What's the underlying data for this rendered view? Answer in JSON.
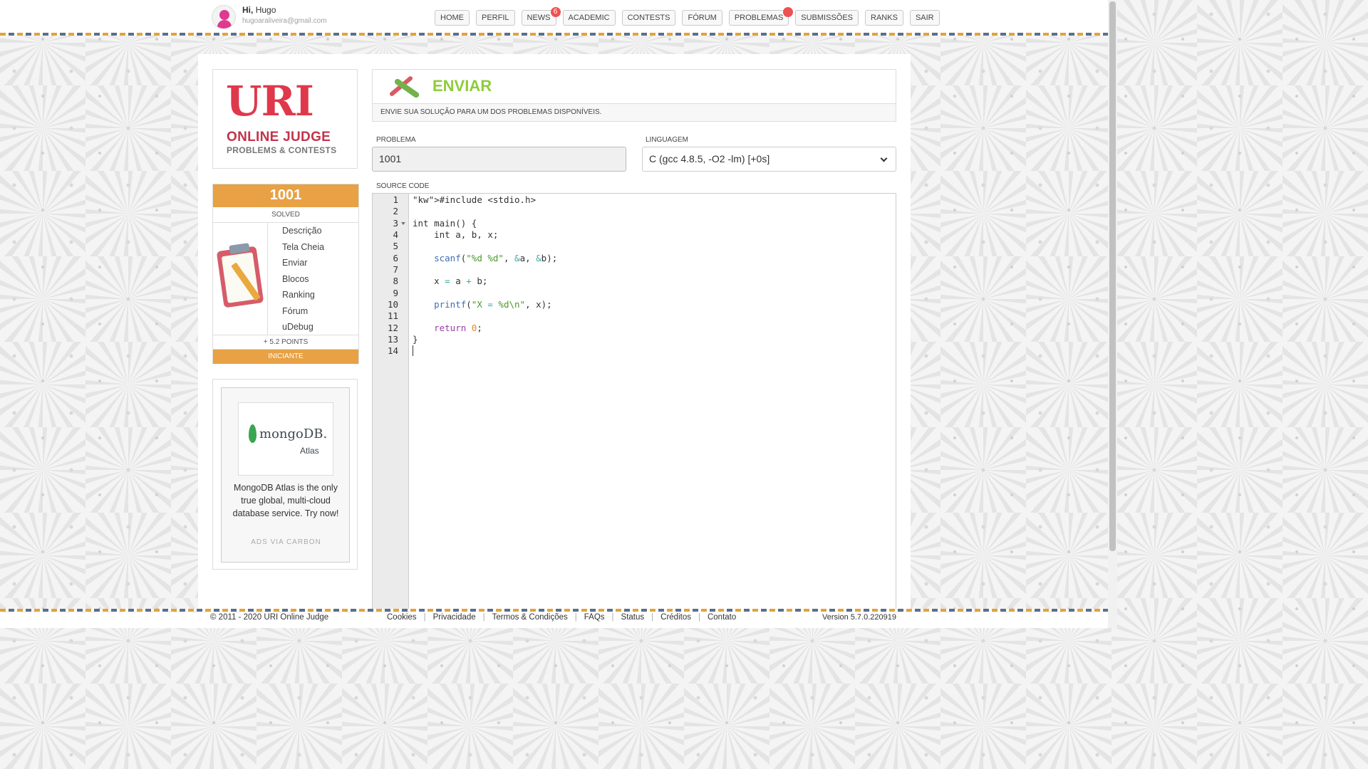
{
  "user": {
    "greeting": "Hi,",
    "name": "Hugo",
    "email": "hugoaraliveira@gmail.com"
  },
  "nav": [
    {
      "label": "HOME",
      "badge": ""
    },
    {
      "label": "PERFIL",
      "badge": ""
    },
    {
      "label": "NEWS",
      "badge": "6"
    },
    {
      "label": "ACADEMIC",
      "badge": ""
    },
    {
      "label": "CONTESTS",
      "badge": ""
    },
    {
      "label": "FÓRUM",
      "badge": ""
    },
    {
      "label": "PROBLEMAS",
      "badge": " "
    },
    {
      "label": "SUBMISSÕES",
      "badge": ""
    },
    {
      "label": "RANKS",
      "badge": ""
    },
    {
      "label": "SAIR",
      "badge": ""
    }
  ],
  "logo": {
    "line1": "URI",
    "line2": "ONLINE JUDGE",
    "line3": "PROBLEMS & CONTESTS"
  },
  "problem_card": {
    "number": "1001",
    "status": "SOLVED",
    "menu": [
      "Descrição",
      "Tela Cheia",
      "Enviar",
      "Blocos",
      "Ranking",
      "Fórum",
      "uDebug"
    ],
    "points": "+ 5.2 POINTS",
    "level": "INICIANTE"
  },
  "ad": {
    "brand": "mongoDB.",
    "product": "Atlas",
    "text": "MongoDB Atlas is the only true global, multi-cloud database service. Try now!",
    "via": "ADS VIA CARBON"
  },
  "page": {
    "title": "ENVIAR",
    "subtitle": "ENVIE SUA SOLUÇÃO PARA UM DOS PROBLEMAS DISPONÍVEIS."
  },
  "form": {
    "problem_label": "PROBLEMA",
    "problem_value": "1001",
    "language_label": "LINGUAGEM",
    "language_value": "C (gcc 4.8.5, -O2 -lm) [+0s]",
    "source_label": "SOURCE CODE"
  },
  "code": {
    "line_numbers": [
      "1",
      "2",
      "3",
      "4",
      "5",
      "6",
      "7",
      "8",
      "9",
      "10",
      "11",
      "12",
      "13",
      "14"
    ],
    "lines": [
      "#include <stdio.h>",
      "",
      "int main() {",
      "    int a, b, x;",
      "",
      "    scanf(\"%d %d\", &a, &b);",
      "",
      "    x = a + b;",
      "",
      "    printf(\"X = %d\\n\", x);",
      "",
      "    return 0;",
      "}",
      ""
    ]
  },
  "footer": {
    "copyright": "© 2011 - 2020 URI Online Judge",
    "links": [
      "Cookies",
      "Privacidade",
      "Termos & Condições",
      "FAQs",
      "Status",
      "Créditos",
      "Contato"
    ],
    "version": "Version 5.7.0.220919"
  },
  "colors": {
    "accent_orange": "#e8a144",
    "title_green": "#8fcc3a",
    "logo_red": "#e0384b"
  }
}
